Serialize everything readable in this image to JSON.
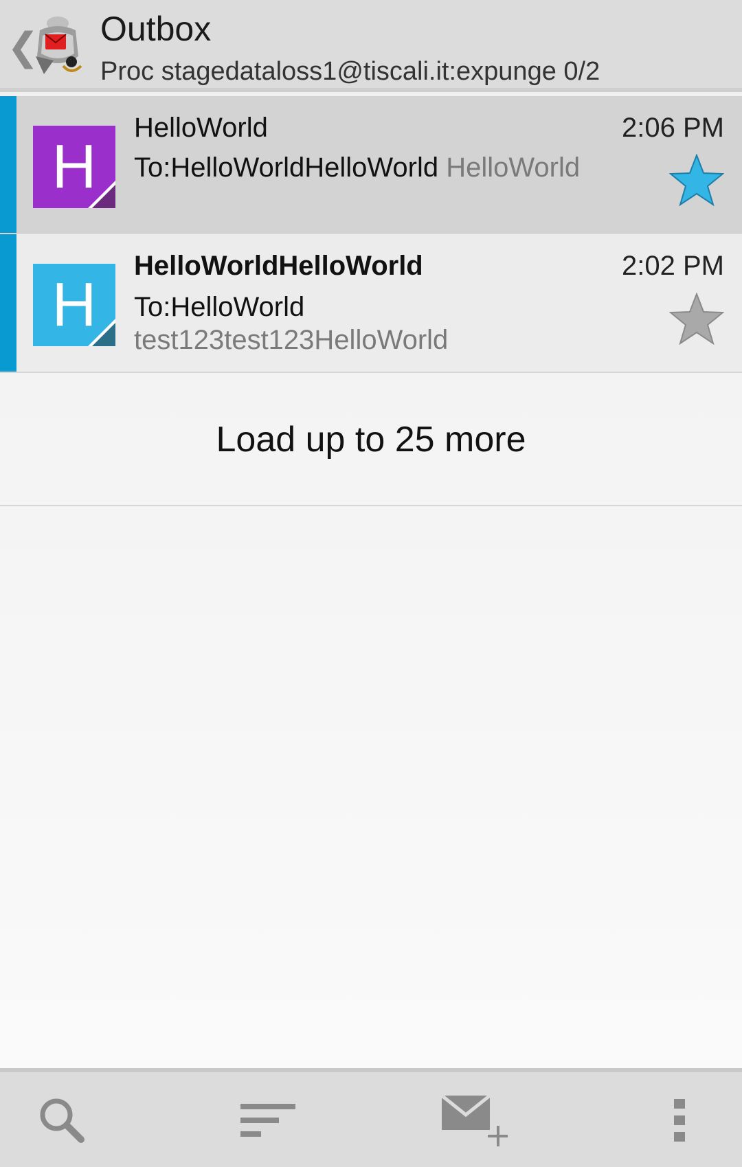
{
  "header": {
    "back_glyph": "❮",
    "title": "Outbox",
    "subtitle": "Proc stagedataloss1@tiscali.it:expunge 0/2",
    "app_icon": "k9-mail-dog-icon"
  },
  "messages": [
    {
      "avatar_letter": "H",
      "avatar_color": "#9a2fcc",
      "sender": "HelloWorld",
      "time": "2:06 PM",
      "to": "To:HelloWorldHelloWorld",
      "preview": "HelloWorld",
      "starred": true,
      "selected": true,
      "bold": false
    },
    {
      "avatar_letter": "H",
      "avatar_color": "#33b5e5",
      "sender": "HelloWorldHelloWorld",
      "time": "2:02 PM",
      "to": "To:HelloWorld",
      "preview": "test123test123HelloWorld",
      "starred": false,
      "selected": false,
      "bold": true
    }
  ],
  "load_more": "Load up to 25 more",
  "toolbar": {
    "icons": [
      "search-icon",
      "sort-icon",
      "compose-icon",
      "overflow-menu-icon"
    ]
  },
  "colors": {
    "accent_bar": "#0a9ad2",
    "star_on": "#33b5e5",
    "star_off": "#a9a9a9"
  }
}
